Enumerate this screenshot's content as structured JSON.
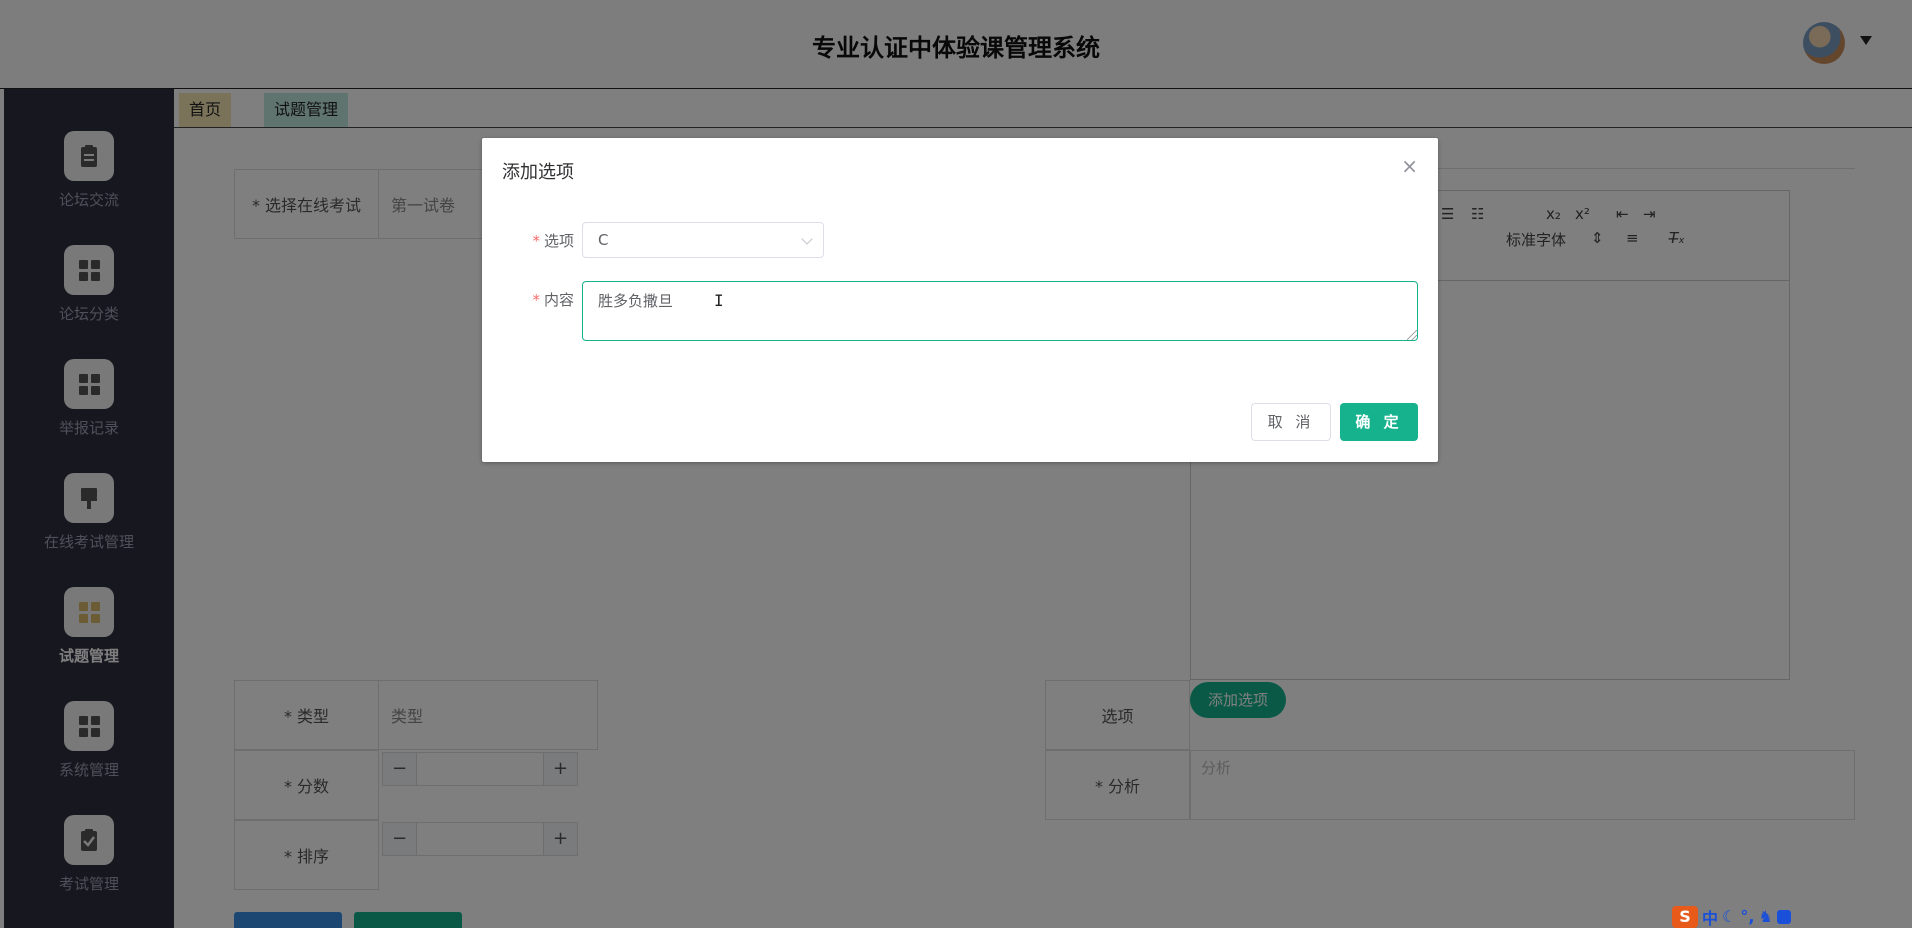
{
  "header": {
    "title": "专业认证中体验课管理系统"
  },
  "sidebar": {
    "items": [
      {
        "label": "论坛交流"
      },
      {
        "label": "论坛分类"
      },
      {
        "label": "举报记录"
      },
      {
        "label": "在线考试管理"
      },
      {
        "label": "试题管理"
      },
      {
        "label": "系统管理"
      },
      {
        "label": "考试管理"
      }
    ]
  },
  "tabs": [
    {
      "label": "首页"
    },
    {
      "label": "试题管理"
    }
  ],
  "form": {
    "exam_label": "* 选择在线考试",
    "exam_value": "第一试卷",
    "type_label": "* 类型",
    "type_placeholder": "类型",
    "score_label": "* 分数",
    "order_label": "* 排序",
    "option_label": "选项",
    "add_option_label": "添加选项",
    "analysis_label": "* 分析",
    "analysis_placeholder": "分析"
  },
  "editor": {
    "font_select": "标准字体"
  },
  "dialog": {
    "title": "添加选项",
    "option_label": "选项",
    "option_value": "C",
    "content_label": "内容",
    "content_value": "胜多负撒旦",
    "cancel_label": "取 消",
    "ok_label": "确 定"
  },
  "ime": {
    "mode": "中"
  }
}
